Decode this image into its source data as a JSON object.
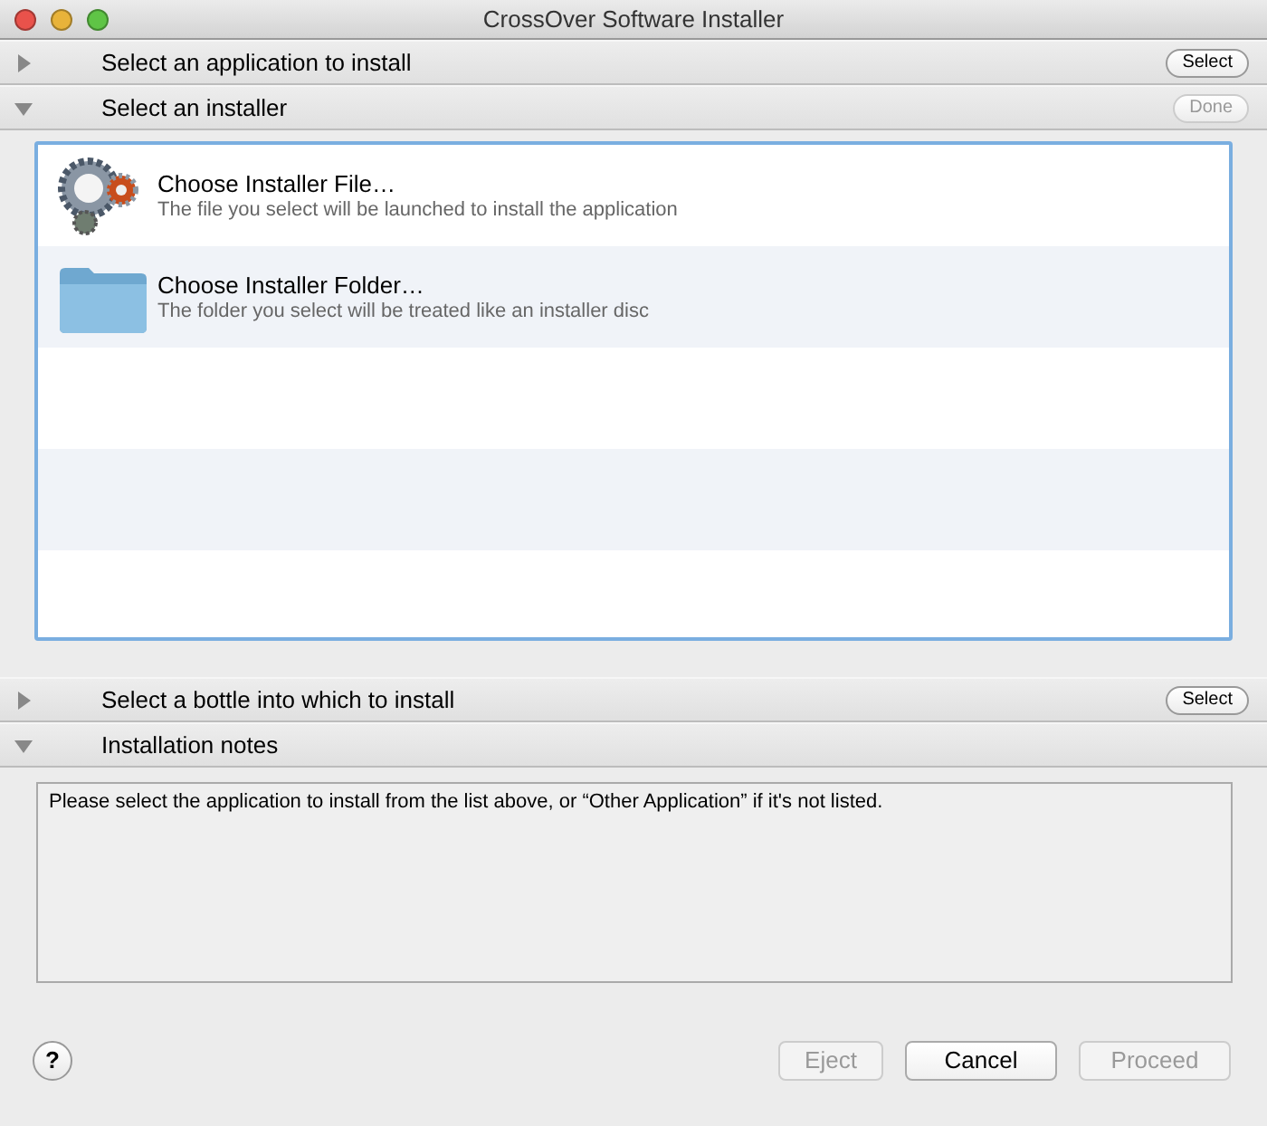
{
  "window": {
    "title": "CrossOver Software Installer"
  },
  "sections": [
    {
      "title": "Select an application to install",
      "expanded": false,
      "button": {
        "label": "Select",
        "disabled": false
      }
    },
    {
      "title": "Select an installer",
      "expanded": true,
      "button": {
        "label": "Done",
        "disabled": true
      }
    },
    {
      "title": "Select a bottle into which to install",
      "expanded": false,
      "button": {
        "label": "Select",
        "disabled": false
      }
    },
    {
      "title": "Installation notes",
      "expanded": true
    }
  ],
  "installers": [
    {
      "kind": "gears",
      "title": "Choose Installer File…",
      "subtitle": "The file you select will be launched to install the application"
    },
    {
      "kind": "folder",
      "title": "Choose Installer Folder…",
      "subtitle": "The folder you select will be treated like an installer disc"
    }
  ],
  "notes": "Please select the application to install from the list above, or “Other Application” if it's not listed.",
  "help": "?",
  "buttons": [
    {
      "label": "Eject",
      "disabled": true
    },
    {
      "label": "Cancel",
      "disabled": false
    },
    {
      "label": "Proceed",
      "disabled": true
    }
  ]
}
